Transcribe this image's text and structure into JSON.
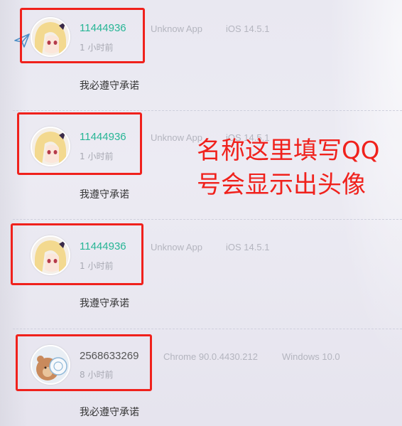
{
  "comments": [
    {
      "nickname": "11444936",
      "browser": "Unknow App",
      "os": "iOS 14.5.1",
      "time": "1 小时前",
      "content": "我必遵守承诺"
    },
    {
      "nickname": "11444936",
      "browser": "Unknow App",
      "os": "iOS 14.5.1",
      "time": "1 小时前",
      "content": "我遵守承诺"
    },
    {
      "nickname": "11444936",
      "browser": "Unknow App",
      "os": "iOS 14.5.1",
      "time": "1 小时前",
      "content": "我遵守承诺"
    },
    {
      "nickname": "2568633269",
      "browser": "Chrome 90.0.4430.212",
      "os": "Windows 10.0",
      "time": "8 小时前",
      "content": "我必遵守承诺"
    }
  ],
  "annotation": {
    "text": "名称这里填写QQ号会显示出头像",
    "color": "#f0211c"
  },
  "colors": {
    "nickname_accent": "#27b595",
    "highlight_box": "#f0211c"
  },
  "icons": {
    "reply": "paper-plane-icon"
  }
}
